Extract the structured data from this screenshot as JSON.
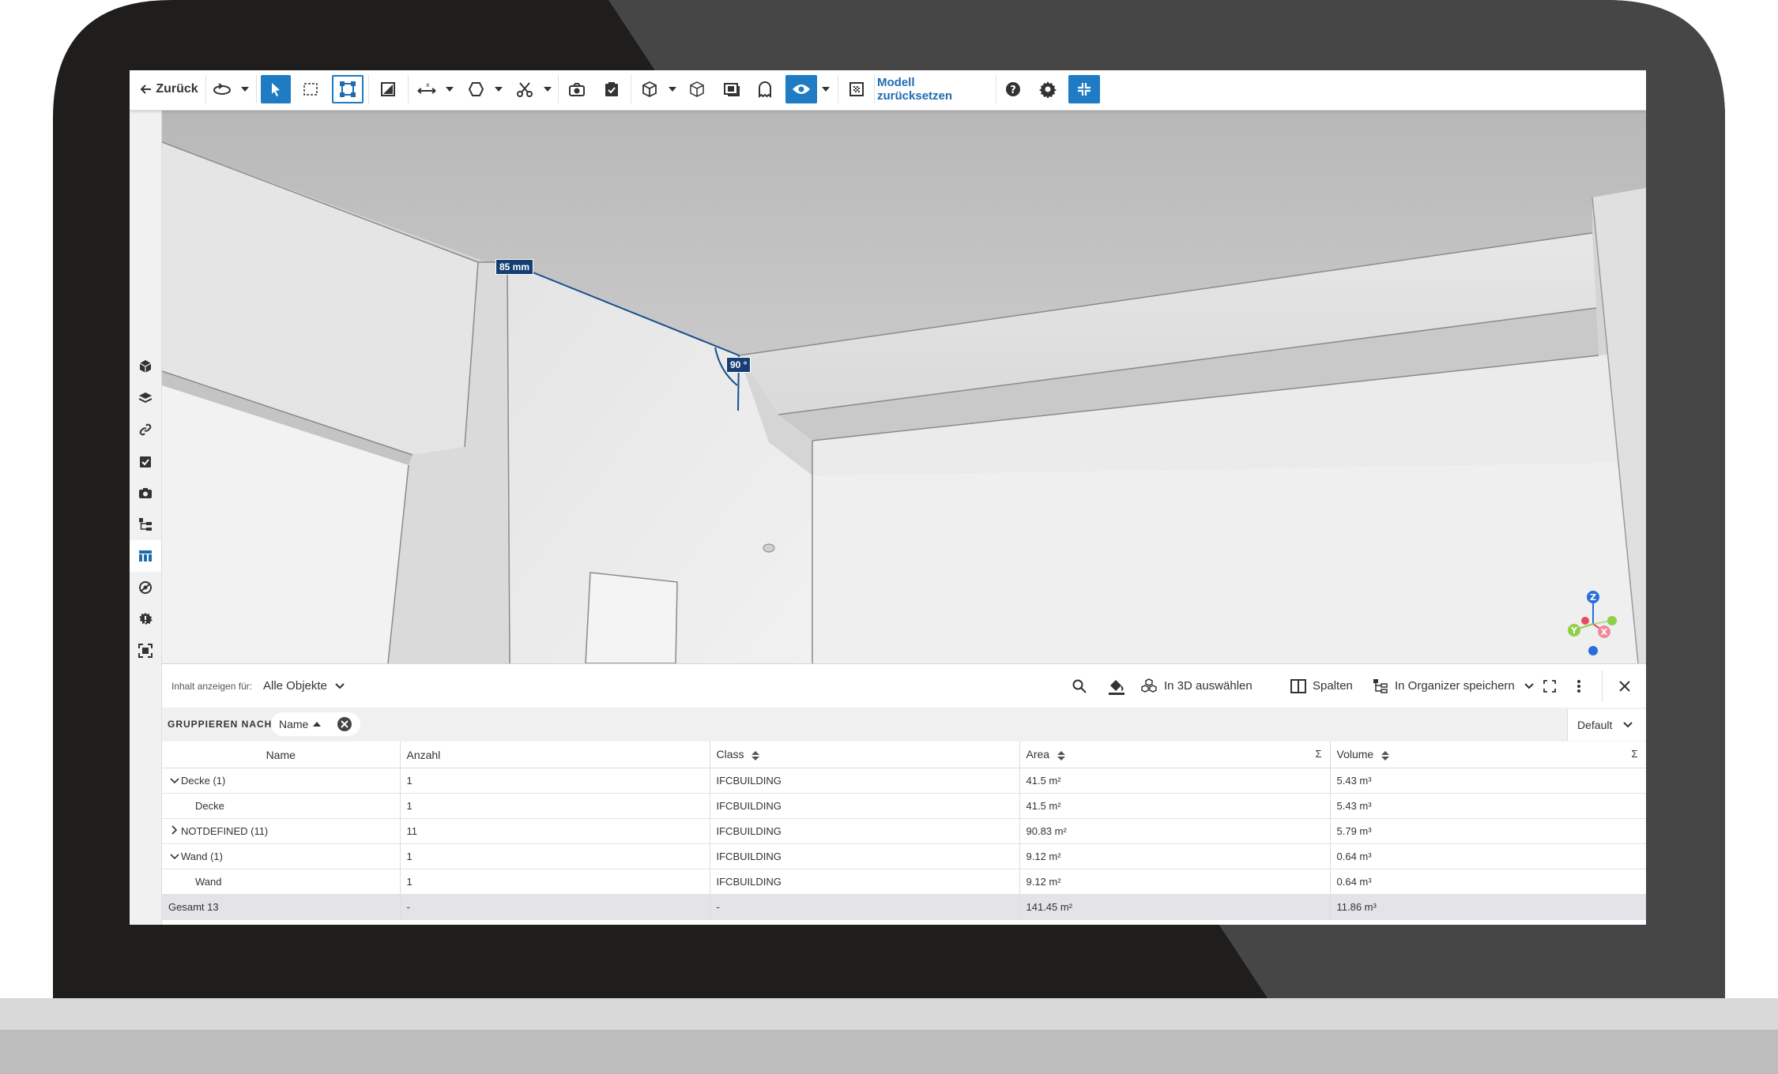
{
  "toolbar": {
    "back_label": "Zurück",
    "reset_model_label": "Modell zurücksetzen"
  },
  "viewport": {
    "dimension_label": "85 mm",
    "angle_label": "90 °",
    "axes": {
      "z": "Z",
      "y": "Y",
      "x": "X"
    }
  },
  "panel": {
    "show_content_label": "Inhalt anzeigen für:",
    "show_content_value": "Alle Objekte",
    "select_in_3d_label": "In 3D auswählen",
    "columns_label": "Spalten",
    "save_organizer_label": "In Organizer speichern",
    "group_by_label": "GRUPPIEREN NACH:",
    "group_chip_label": "Name",
    "preset_label": "Default",
    "columns": [
      "Name",
      "Anzahl",
      "Class",
      "Area",
      "Volume"
    ],
    "sigma": "Σ",
    "rows": [
      {
        "name": "Decke (1)",
        "kind": "group-open",
        "count": "1",
        "class": "IFCBUILDING",
        "area": "41.5 m²",
        "volume": "5.43 m³"
      },
      {
        "name": "Decke",
        "kind": "child",
        "count": "1",
        "class": "IFCBUILDING",
        "area": "41.5 m²",
        "volume": "5.43 m³"
      },
      {
        "name": "NOTDEFINED (11)",
        "kind": "group-closed",
        "count": "11",
        "class": "IFCBUILDING",
        "area": "90.83 m²",
        "volume": "5.79 m³"
      },
      {
        "name": "Wand (1)",
        "kind": "group-open",
        "count": "1",
        "class": "IFCBUILDING",
        "area": "9.12 m²",
        "volume": "0.64 m³"
      },
      {
        "name": "Wand",
        "kind": "child",
        "count": "1",
        "class": "IFCBUILDING",
        "area": "9.12 m²",
        "volume": "0.64 m³"
      }
    ],
    "total": {
      "name": "Gesamt 13",
      "count": "-",
      "class": "-",
      "area": "141.45 m²",
      "volume": "11.86 m³"
    }
  }
}
